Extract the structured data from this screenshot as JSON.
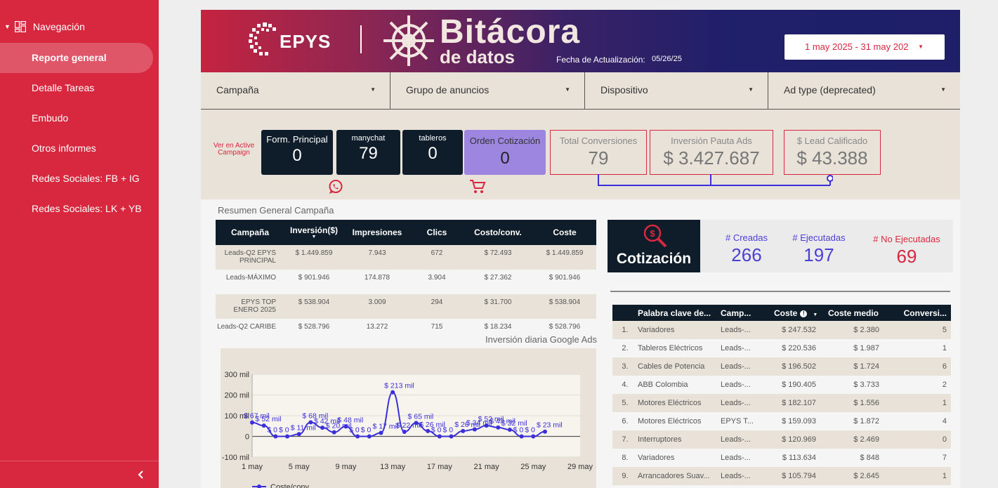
{
  "sidebar": {
    "header": "Navegación",
    "items": [
      {
        "label": "Reporte general"
      },
      {
        "label": "Detalle Tareas"
      },
      {
        "label": "Embudo"
      },
      {
        "label": "Otros informes"
      },
      {
        "label": "Redes Sociales: FB + IG"
      },
      {
        "label": "Redes Sociales: LK + YB"
      }
    ]
  },
  "banner": {
    "brand": "EPYS",
    "title": "Bitácora",
    "subtitle": "de datos",
    "update_label": "Fecha de Actualización:",
    "update_date": "05/26/25",
    "date_range": "1 may 2025 - 31 may 202"
  },
  "filters": [
    "Campaña",
    "Grupo de anuncios",
    "Dispositivo",
    "Ad type (deprecated)"
  ],
  "kpis": {
    "ver_link": "Ver en Active Campaign",
    "form_principal": {
      "label": "Form. Principal",
      "value": "0"
    },
    "manychat": {
      "label": "manychat",
      "value": "79"
    },
    "tableros": {
      "label": "tableros",
      "value": "0"
    },
    "orden_cotizacion": {
      "label": "Orden Cotización",
      "value": "0"
    },
    "total_conversiones": {
      "label": "Total Conversiones",
      "value": "79"
    },
    "inversion": {
      "label": "Inversión Pauta Ads",
      "value": "$ 3.427.687"
    },
    "lead": {
      "label": "$ Lead Calificado",
      "value": "$ 43.388"
    }
  },
  "summary": {
    "title": "Resumen General Campaña",
    "headers": [
      "Campaña",
      "Inversión($)",
      "Impresiones",
      "Clics",
      "Costo/conv.",
      "Coste"
    ],
    "rows": [
      [
        "Leads-Q2 EPYS PRINCIPAL",
        "$ 1.449.859",
        "7.943",
        "672",
        "$ 72.493",
        "$ 1.449.859"
      ],
      [
        "Leads-MÁXIMO",
        "$ 901.946",
        "174.878",
        "3.904",
        "$ 27.362",
        "$ 901.946"
      ],
      [
        "EPYS TOP ENERO 2025",
        "$ 538.904",
        "3.009",
        "294",
        "$ 31.700",
        "$ 538.904"
      ],
      [
        "Leads-Q2 CARIBE",
        "$ 528.796",
        "13.272",
        "715",
        "$ 18.234",
        "$ 528.796"
      ]
    ]
  },
  "chart_data": {
    "type": "line",
    "title": "Inversión diaria Google Ads",
    "x_tick_labels": [
      "1 may",
      "5 may",
      "9 may",
      "13 may",
      "17 may",
      "21 may",
      "25 may",
      "29 may"
    ],
    "y_tick_labels": [
      "300 mil",
      "200 mil",
      "100 mil",
      "0",
      "-100 mil"
    ],
    "ylim": [
      -100000,
      300000
    ],
    "series": [
      {
        "name": "Coste/conv.",
        "color": "#3b2fd9",
        "x": [
          1,
          2,
          3,
          4,
          5,
          6,
          7,
          8,
          9,
          10,
          11,
          12,
          13,
          14,
          15,
          16,
          17,
          18,
          19,
          20,
          21,
          22,
          23,
          24,
          25,
          26,
          27
        ],
        "values": [
          67000,
          52000,
          0,
          0,
          11000,
          68000,
          42000,
          20000,
          48000,
          0,
          0,
          17000,
          213000,
          22000,
          65000,
          26000,
          0,
          0,
          26000,
          34000,
          52000,
          43000,
          32000,
          0,
          0,
          23000,
          null
        ],
        "point_labels": [
          "$ 67 mil",
          "$ 52 mil",
          "$ 0",
          "$ 0",
          "$ 11 mil",
          "$ 68 mil",
          "$ 42 mil",
          "$ 20 mil",
          "$ 48 mil",
          "$ 0",
          "$ 0",
          "$ 17 mil",
          "$ 213 mil",
          "$ 22 mil",
          "$ 65 mil",
          "$ 26 mil",
          "$ 0",
          "$ 0",
          "$ 26 mil",
          "$ 34 mil",
          "$ 52 mil",
          "$ 43 mil",
          "$ 32 mil",
          "$ 0",
          "$ 0",
          "$ 23 mil",
          ""
        ]
      }
    ],
    "legend": "bottom-left"
  },
  "cotizacion": {
    "title": "Cotización",
    "creadas": {
      "label": "# Creadas",
      "value": "266"
    },
    "ejecutadas": {
      "label": "# Ejecutadas",
      "value": "197"
    },
    "no_ejecutadas": {
      "label": "# No Ejecutadas",
      "value": "69"
    }
  },
  "keywords": {
    "headers": [
      "Palabra clave de...",
      "Camp...",
      "Coste",
      "Coste medio",
      "Conversi..."
    ],
    "rows": [
      [
        "1.",
        "Variadores",
        "Leads-...",
        "$ 247.532",
        "$ 2.380",
        "5"
      ],
      [
        "2.",
        "Tableros Eléctricos",
        "Leads-...",
        "$ 220.536",
        "$ 1.987",
        "1"
      ],
      [
        "3.",
        "Cables de Potencia",
        "Leads-...",
        "$ 196.502",
        "$ 1.724",
        "6"
      ],
      [
        "4.",
        "ABB Colombia",
        "Leads-...",
        "$ 190.405",
        "$ 3.733",
        "2"
      ],
      [
        "5.",
        "Motores Eléctricos",
        "Leads-...",
        "$ 182.107",
        "$ 1.556",
        "1"
      ],
      [
        "6.",
        "Motores Eléctricos",
        "EPYS T...",
        "$ 159.093",
        "$ 1.872",
        "4"
      ],
      [
        "7.",
        "Interruptores",
        "Leads-...",
        "$ 120.969",
        "$ 2.469",
        "0"
      ],
      [
        "8.",
        "Variadores",
        "Leads-...",
        "$ 113.634",
        "$ 848",
        "7"
      ],
      [
        "9.",
        "Arrancadores Suav...",
        "Leads-...",
        "$ 105.794",
        "$ 2.645",
        "1"
      ]
    ]
  },
  "colors": {
    "brand_red": "#d8283f",
    "navy": "#0f1d2a",
    "purple": "#9c86e0",
    "line_blue": "#3b2fd9",
    "beige": "#e8e2d8"
  }
}
